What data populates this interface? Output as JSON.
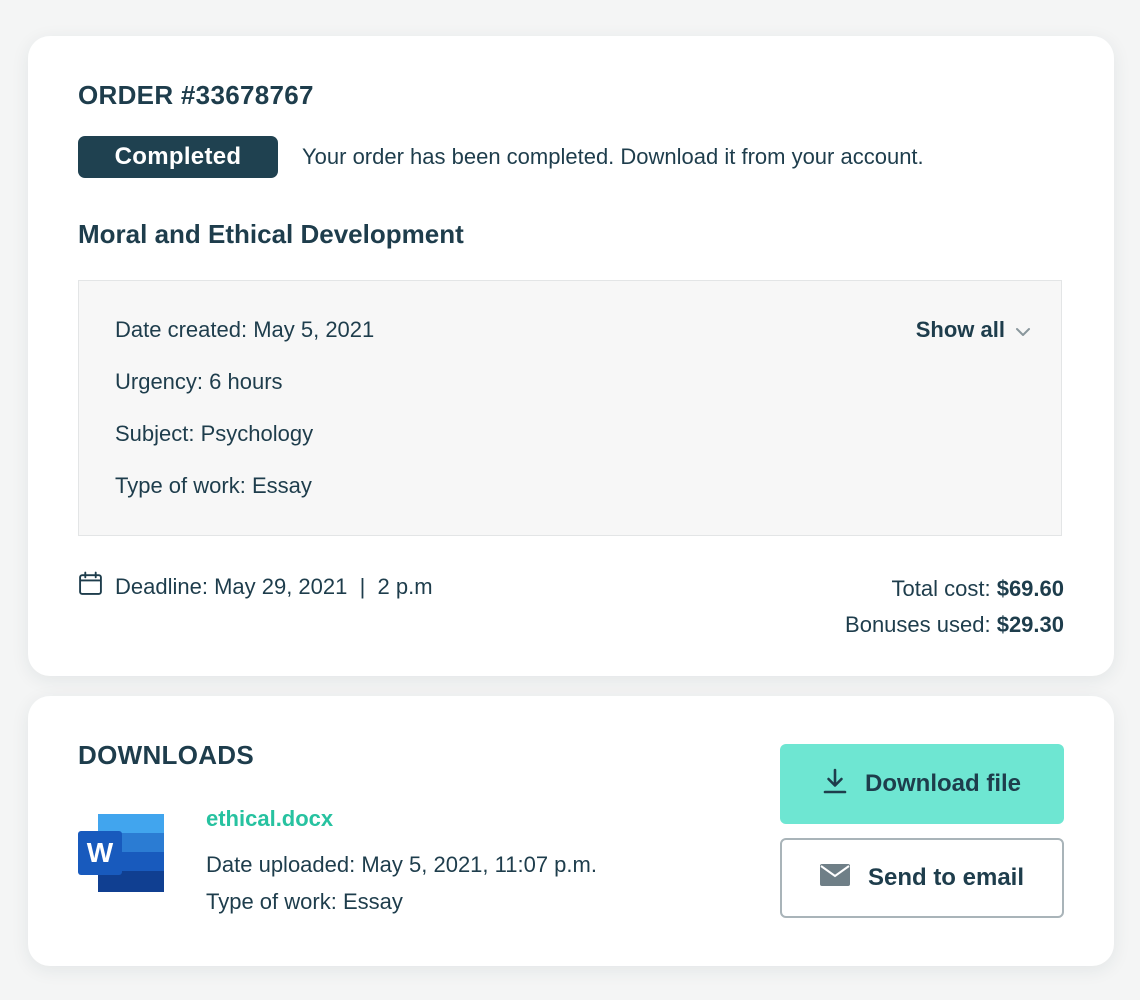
{
  "order": {
    "title": "ORDER #33678767",
    "status": "Completed",
    "status_message": "Your order has been completed. Download it from your account.",
    "name": "Moral and Ethical Development",
    "details": {
      "date_created": "Date created: May 5, 2021",
      "urgency": "Urgency: 6 hours",
      "subject": "Subject: Psychology",
      "type_of_work": "Type of work: Essay",
      "show_all_label": "Show all"
    },
    "deadline": "Deadline: May 29, 2021  |  2 p.m",
    "total_cost_label": "Total cost:",
    "total_cost_value": "$69.60",
    "bonuses_label": "Bonuses used:",
    "bonuses_value": "$29.30"
  },
  "downloads": {
    "title": "DOWNLOADS",
    "file": {
      "name": "ethical.docx",
      "icon": "word-document-icon",
      "icon_letter": "W",
      "date_uploaded": "Date uploaded: May 5, 2021, 11:07 p.m.",
      "type_of_work": "Type of work: Essay"
    },
    "download_button": "Download file",
    "email_button": "Send to email"
  },
  "colors": {
    "primary_text": "#1e3d4c",
    "badge_bg": "#1f4150",
    "accent_teal": "#6ee6d2",
    "link_green": "#27c2a0"
  }
}
